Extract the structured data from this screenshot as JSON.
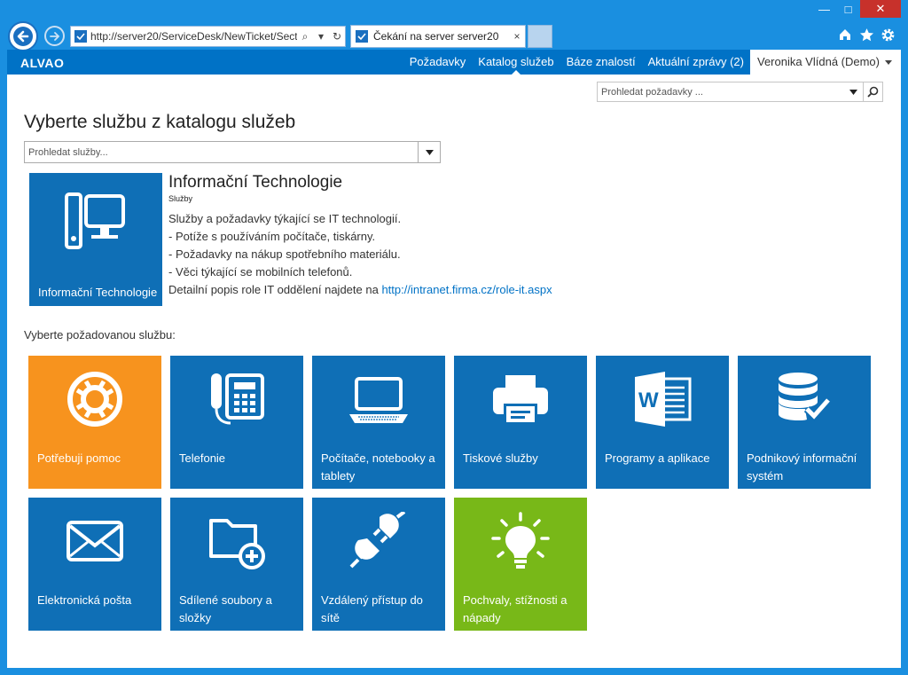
{
  "browser": {
    "address": "http://server20/ServiceDesk/NewTicket/Sect",
    "tab_title": "Čekání na server server20",
    "tab_close": "×",
    "search_glyph": "⌕",
    "dropdown_glyph": "▾",
    "refresh_glyph": "↻"
  },
  "window": {
    "minimize": "—",
    "maximize": "□",
    "close": "✕"
  },
  "app": {
    "logo": "ALVAO",
    "menu": [
      "Požadavky",
      "Katalog služeb",
      "Báze znalostí",
      "Aktuální zprávy (2)"
    ],
    "active_menu": "Katalog služeb",
    "user": "Veronika Vlídná (Demo)",
    "request_search_placeholder": "Prohledat požadavky ..."
  },
  "page": {
    "title": "Vyberte službu z katalogu služeb",
    "service_search_placeholder": "Prohledat služby..."
  },
  "category": {
    "tile_label": "Informační Technologie",
    "heading": "Informační Technologie",
    "subheading": "Služby",
    "lines": [
      "Služby a požadavky týkající se IT technologií.",
      "- Potíže s používáním počítače, tiskárny.",
      "- Požadavky na nákup spotřebního materiálu.",
      "- Věci týkající se mobilních telefonů."
    ],
    "detail_prefix": "Detailní popis role IT oddělení najdete na ",
    "detail_link": "http://intranet.firma.cz/role-it.aspx"
  },
  "services_label": "Vyberte požadovanou službu:",
  "services": [
    {
      "label": "Potřebuji pomoc",
      "icon": "lifebuoy-icon",
      "color": "#f7931e"
    },
    {
      "label": "Telefonie",
      "icon": "phone-icon",
      "color": "#0f6fb6"
    },
    {
      "label": "Počítače, notebooky a tablety",
      "icon": "laptop-icon",
      "color": "#0f6fb6"
    },
    {
      "label": "Tiskové služby",
      "icon": "printer-icon",
      "color": "#0f6fb6"
    },
    {
      "label": "Programy a aplikace",
      "icon": "word-icon",
      "color": "#0f6fb6"
    },
    {
      "label": "Podnikový informační systém",
      "icon": "database-check-icon",
      "color": "#0f6fb6"
    },
    {
      "label": "Elektronická pošta",
      "icon": "envelope-icon",
      "color": "#0f6fb6"
    },
    {
      "label": "Sdílené soubory a složky",
      "icon": "folder-add-icon",
      "color": "#0f6fb6"
    },
    {
      "label": "Vzdálený přístup do sítě",
      "icon": "plug-icon",
      "color": "#0f6fb6"
    },
    {
      "label": "Pochvaly, stížnosti a nápady",
      "icon": "lightbulb-icon",
      "color": "#78b818"
    }
  ],
  "colors": {
    "brand": "#0072c6",
    "tile_blue": "#0f6fb6",
    "orange": "#f7931e",
    "green": "#78b818"
  }
}
